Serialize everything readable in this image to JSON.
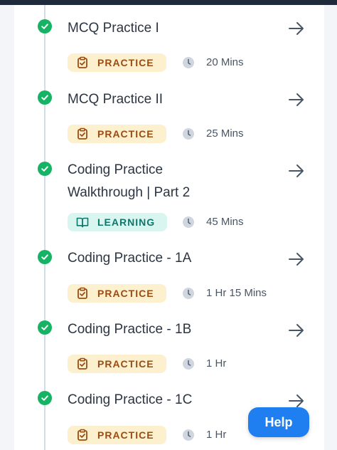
{
  "items": [
    {
      "title": "MCQ Practice I",
      "badge": "PRACTICE",
      "duration": "20 Mins"
    },
    {
      "title": "MCQ Practice II",
      "badge": "PRACTICE",
      "duration": "25 Mins"
    },
    {
      "title_line1": "Coding Practice",
      "title_line2": "Walkthrough | Part 2",
      "badge": "LEARNING",
      "duration": "45 Mins"
    },
    {
      "title": "Coding Practice - 1A",
      "badge": "PRACTICE",
      "duration": "1 Hr 15 Mins"
    },
    {
      "title": "Coding Practice - 1B",
      "badge": "PRACTICE",
      "duration": "1 Hr"
    },
    {
      "title": "Coding Practice - 1C",
      "badge": "PRACTICE",
      "duration": "1 Hr"
    }
  ],
  "help_label": "Help",
  "colors": {
    "check": "#16b364",
    "practice_bg": "#fdf0cf",
    "practice_text": "#9a4d12",
    "learning_bg": "#d8f6ef",
    "learning_text": "#10766c",
    "help_button": "#1f7ff0"
  },
  "icons": {
    "status": "check-circle-icon",
    "open": "arrow-right-icon",
    "practice": "clipboard-check-icon",
    "learning": "book-open-icon",
    "time": "clock-icon"
  }
}
